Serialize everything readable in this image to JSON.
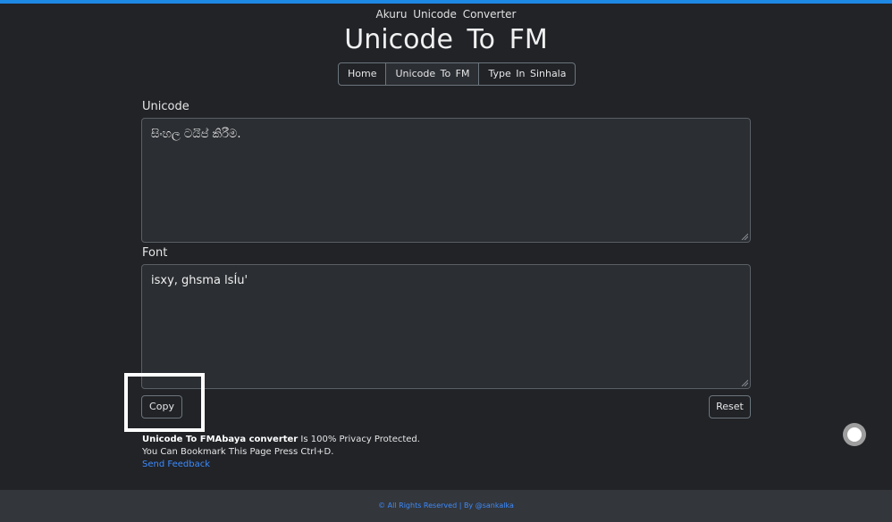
{
  "header": {
    "brand": "Akuru Unicode Converter",
    "title": "Unicode To FM"
  },
  "nav": {
    "items": [
      {
        "label": "Home"
      },
      {
        "label": "Unicode To FM"
      },
      {
        "label": "Type In Sinhala"
      }
    ],
    "active_index": 1
  },
  "unicode": {
    "label": "Unicode",
    "value": "සිංහල ටයිප් කිරීම."
  },
  "font": {
    "label": "Font",
    "value": "isxy, ghsma lsÍu'"
  },
  "actions": {
    "copy_label": "Copy",
    "reset_label": "Reset"
  },
  "info": {
    "bold_text": "Unicode To FMAbaya converter",
    "privacy_text": " Is 100% Privacy Protected.",
    "bookmark_text": "You Can Bookmark This Page Press Ctrl+D.",
    "feedback_link": "Send Feedback"
  },
  "footer": {
    "text": "© All Rights Reserved | By @sankalka"
  },
  "colors": {
    "background": "#212327",
    "accent": "#1e88e5",
    "link": "#3d8bfd"
  }
}
